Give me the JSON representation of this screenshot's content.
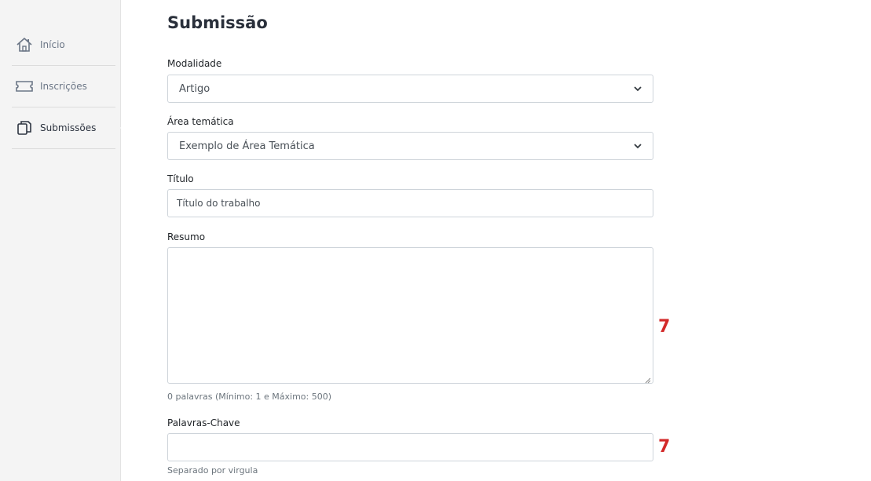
{
  "sidebar": {
    "items": [
      {
        "label": "Início",
        "icon": "home-icon",
        "active": false
      },
      {
        "label": "Inscrições",
        "icon": "ticket-icon",
        "active": false
      },
      {
        "label": "Submissões",
        "icon": "documents-icon",
        "active": true
      }
    ]
  },
  "page": {
    "title": "Submissão"
  },
  "form": {
    "modalidade": {
      "label": "Modalidade",
      "value": "Artigo"
    },
    "area": {
      "label": "Área temática",
      "value": "Exemplo de Área Temática"
    },
    "titulo": {
      "label": "Título",
      "placeholder": "Título do trabalho"
    },
    "resumo": {
      "label": "Resumo",
      "help": "0 palavras (Mínimo: 1 e Máximo: 500)",
      "counter": "7"
    },
    "palavras": {
      "label": "Palavras-Chave",
      "help": "Separado por virgula",
      "counter": "7"
    }
  },
  "colors": {
    "sidebar_bg": "#f4f4f4",
    "counter": "#d32a2a",
    "border": "#ced4da"
  }
}
